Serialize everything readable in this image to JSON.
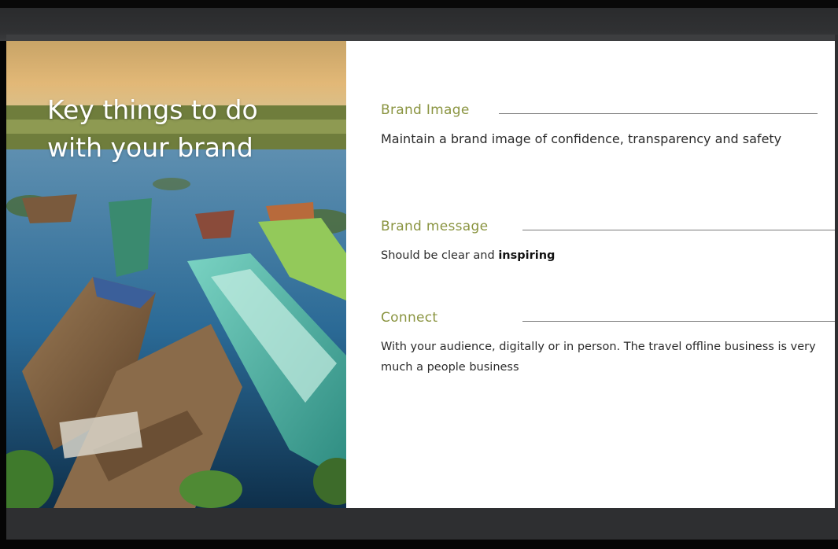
{
  "slide": {
    "title_line1": "Key things to do",
    "title_line2": "with your brand",
    "sections": [
      {
        "heading": "Brand Image",
        "text": "Maintain a brand image of confidence, transparency and safety"
      },
      {
        "heading": "Brand message",
        "text_before": "Should be clear and ",
        "text_bold": "inspiring"
      },
      {
        "heading": "Connect",
        "text": "With your audience, digitally or in person. The travel offline business is very much a people business"
      }
    ]
  },
  "colors": {
    "heading": "#8a9440",
    "body_text": "#2b2b2b",
    "toolbar": "#2e2f31",
    "background": "#050505"
  }
}
